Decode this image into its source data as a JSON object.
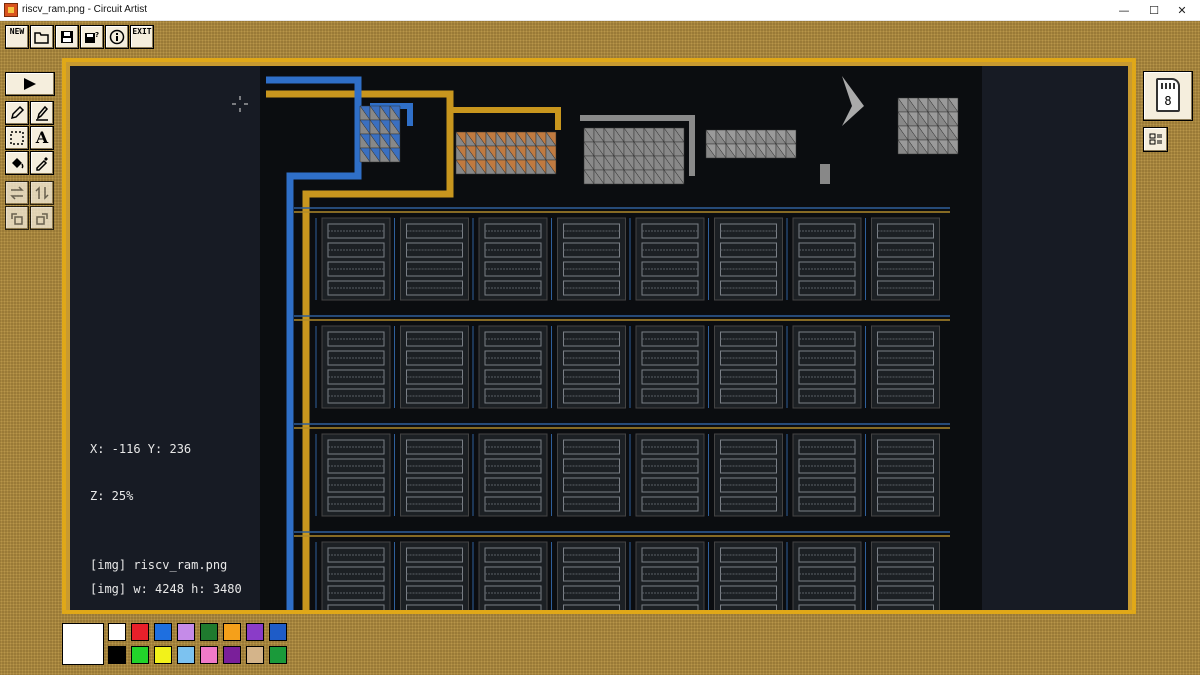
{
  "window": {
    "title": "riscv_ram.png - Circuit Artist",
    "minimize": "—",
    "maximize": "☐",
    "close": "✕"
  },
  "toolbar": {
    "new_label": "NEW",
    "open_icon": "folder-open-icon",
    "save_icon": "floppy-disk-icon",
    "save_as_icon": "floppy-disk-question-icon",
    "about_icon": "info-icon",
    "exit_label": "EXIT"
  },
  "tools": {
    "simulate_icon": "play-icon",
    "brush_icon": "pencil-icon",
    "line_icon": "line-pencil-icon",
    "select_icon": "marquee-select-icon",
    "text_label": "A",
    "fill_icon": "paint-bucket-icon",
    "picker_icon": "eyedropper-icon",
    "flip_h_icon": "flip-horizontal-icon",
    "flip_v_icon": "flip-vertical-icon",
    "rotate_ccw_icon": "rotate-ccw-icon",
    "rotate_cw_icon": "rotate-cw-icon"
  },
  "status": {
    "coords": "X: -116 Y: 236",
    "zoom": "Z: 25%",
    "image_name": "[img] riscv_ram.png",
    "image_size": "[img] w: 4248 h: 3480"
  },
  "layers": {
    "count": "8",
    "settings_icon": "layer-settings-icon"
  },
  "palette": {
    "primary": "#ffffff",
    "colors": [
      "#ffffff",
      "#e8202a",
      "#1e6fe0",
      "#c58be8",
      "#1f7a2e",
      "#f5a01a",
      "#8a3cc8",
      "#1e5cc8",
      "#000000",
      "#22d42a",
      "#f2f21a",
      "#7cc2f0",
      "#f07ac8",
      "#7a1f9a",
      "#d4b48a",
      "#1a9a3a"
    ]
  },
  "colors": {
    "wire_blue": "#2f6fc8",
    "wire_yellow": "#c8961e",
    "frame_gold": "#e0a818"
  }
}
